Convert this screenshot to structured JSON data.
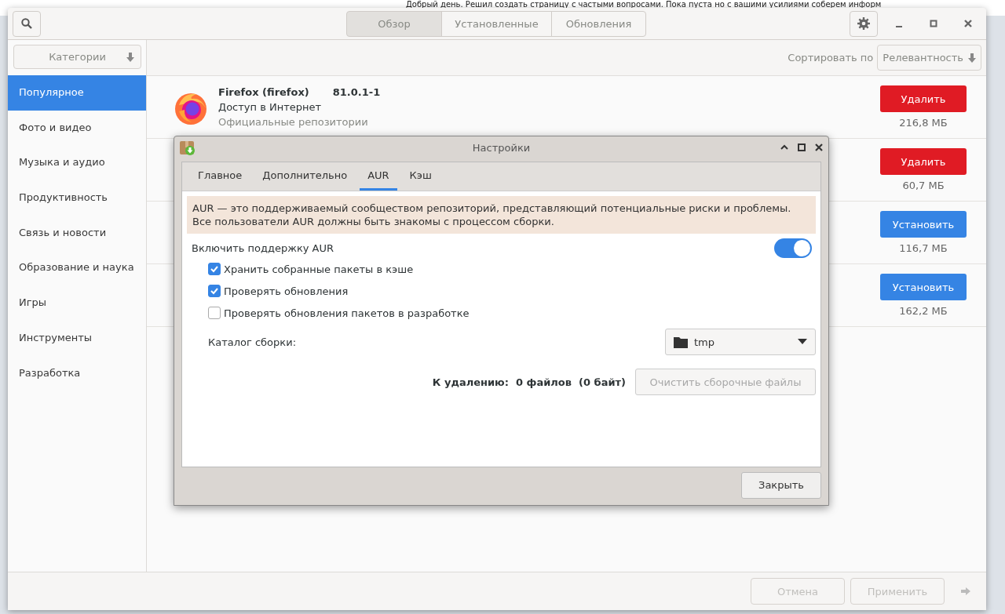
{
  "background_page": {
    "text": "Добрый день. Решил создать страницу с частыми вопросами. Пока пуста но с вашими усилиями соберем информ"
  },
  "view_tabs": [
    {
      "label": "Обзор",
      "selected": true
    },
    {
      "label": "Установленные",
      "selected": false
    },
    {
      "label": "Обновления",
      "selected": false
    }
  ],
  "category_dropdown": {
    "value": "Категории"
  },
  "categories": [
    {
      "label": "Популярное",
      "selected": true
    },
    {
      "label": "Фото и видео",
      "selected": false
    },
    {
      "label": "Музыка и аудио",
      "selected": false
    },
    {
      "label": "Продуктивность",
      "selected": false
    },
    {
      "label": "Связь и новости",
      "selected": false
    },
    {
      "label": "Образование и наука",
      "selected": false
    },
    {
      "label": "Игры",
      "selected": false
    },
    {
      "label": "Инструменты",
      "selected": false
    },
    {
      "label": "Разработка",
      "selected": false
    }
  ],
  "sort": {
    "label": "Сортировать по",
    "value": "Релевантность"
  },
  "packages": [
    {
      "name": "Firefox (firefox)",
      "version": "81.0.1-1",
      "description": "Доступ в Интернет",
      "repo": "Официальные репозитории",
      "action": {
        "kind": "remove",
        "label": "Удалить"
      },
      "size": "216,8 МБ"
    },
    {
      "action": {
        "kind": "remove",
        "label": "Удалить"
      },
      "size": "60,7 МБ"
    },
    {
      "action": {
        "kind": "install",
        "label": "Установить"
      },
      "size": "116,7 МБ"
    },
    {
      "action": {
        "kind": "install",
        "label": "Установить"
      },
      "size": "162,2 МБ"
    }
  ],
  "footer_buttons": [
    {
      "label": "Отмена",
      "disabled": true
    },
    {
      "label": "Применить",
      "disabled": true
    }
  ],
  "dialog": {
    "title": "Настройки",
    "tabs": [
      {
        "label": "Главное",
        "selected": false
      },
      {
        "label": "Дополнительно",
        "selected": false
      },
      {
        "label": "AUR",
        "selected": true
      },
      {
        "label": "Кэш",
        "selected": false
      }
    ],
    "notice": "AUR — это поддерживаемый сообществом репозиторий, представляющий потенциальные риски и проблемы.\nВсе пользователи AUR должны быть знакомы с процессом сборки.",
    "toggle": {
      "label": "Включить поддержку AUR",
      "on": true
    },
    "checkboxes": [
      {
        "label": "Хранить собранные пакеты в кэше",
        "checked": true
      },
      {
        "label": "Проверять обновления",
        "checked": true
      },
      {
        "label": "Проверять обновления пакетов в разработке",
        "checked": false
      }
    ],
    "build_dir": {
      "label": "Каталог сборки:",
      "value": "tmp"
    },
    "cleanup": {
      "text": "К удалению:  0 файлов  (0 байт)",
      "button": {
        "label": "Очистить сборочные файлы",
        "disabled": true
      }
    },
    "close_button": "Закрыть"
  }
}
